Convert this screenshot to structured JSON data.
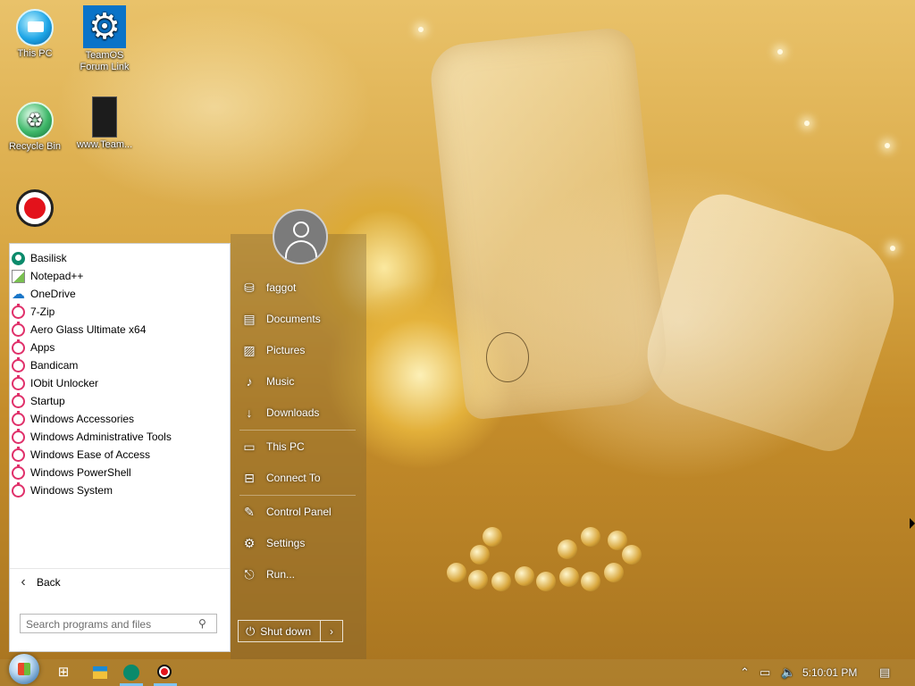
{
  "desktop": {
    "icons": [
      {
        "label": "This PC",
        "icon": "this-pc-icon"
      },
      {
        "label": "TeamOS Forum Link",
        "icon": "gear-icon"
      },
      {
        "label": "Recycle Bin",
        "icon": "recycle-bin-icon"
      },
      {
        "label": "www.Team...",
        "icon": "file-icon"
      },
      {
        "label": "",
        "icon": "record-icon"
      }
    ]
  },
  "start_menu": {
    "programs": [
      {
        "label": "Basilisk",
        "icon": "basilisk-icon"
      },
      {
        "label": "Notepad++",
        "icon": "notepad-icon"
      },
      {
        "label": "OneDrive",
        "icon": "onedrive-icon"
      },
      {
        "label": "7-Zip",
        "icon": "folder-icon"
      },
      {
        "label": "Aero Glass Ultimate x64",
        "icon": "folder-icon"
      },
      {
        "label": "Apps",
        "icon": "folder-icon"
      },
      {
        "label": "Bandicam",
        "icon": "folder-icon"
      },
      {
        "label": "IObit Unlocker",
        "icon": "folder-icon"
      },
      {
        "label": "Startup",
        "icon": "folder-icon"
      },
      {
        "label": "Windows Accessories",
        "icon": "folder-icon"
      },
      {
        "label": "Windows Administrative Tools",
        "icon": "folder-icon"
      },
      {
        "label": "Windows Ease of Access",
        "icon": "folder-icon"
      },
      {
        "label": "Windows PowerShell",
        "icon": "folder-icon"
      },
      {
        "label": "Windows System",
        "icon": "folder-icon"
      }
    ],
    "back_label": "Back",
    "search_placeholder": "Search programs and files",
    "right_items": [
      {
        "label": "faggot",
        "icon": "user-folder-icon"
      },
      {
        "label": "Documents",
        "icon": "documents-icon"
      },
      {
        "label": "Pictures",
        "icon": "pictures-icon"
      },
      {
        "label": "Music",
        "icon": "music-icon"
      },
      {
        "label": "Downloads",
        "icon": "downloads-icon"
      },
      {
        "label": "This PC",
        "icon": "computer-icon"
      },
      {
        "label": "Connect To",
        "icon": "connect-icon"
      },
      {
        "label": "Control Panel",
        "icon": "control-panel-icon"
      },
      {
        "label": "Settings",
        "icon": "gear-icon"
      },
      {
        "label": "Run...",
        "icon": "run-icon"
      }
    ],
    "shutdown_label": "Shut down"
  },
  "taskbar": {
    "clock": "5:10:01 PM"
  },
  "colors": {
    "accent": "#1a76c8",
    "folder_icon": "#e0306a",
    "record_red": "#e3121b"
  }
}
